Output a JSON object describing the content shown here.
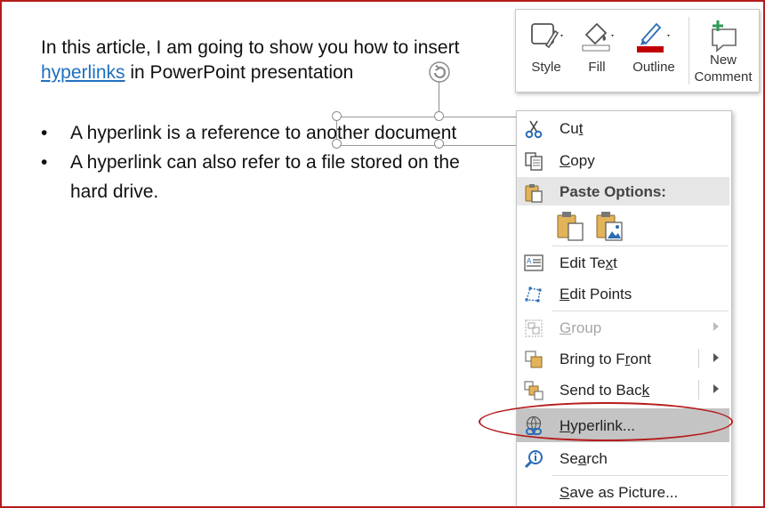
{
  "slide": {
    "intro_text": "In this article, I am going to show you how to insert",
    "intro_link": "hyperlinks",
    "intro_suffix": " in PowerPoint presentation",
    "bullet_char": "•",
    "bullets": [
      {
        "line1": "A hyperlink is a reference to another document"
      },
      {
        "line1": "A hyperlink can also refer to a file stored on the",
        "line2": "hard drive."
      }
    ]
  },
  "mini_toolbar": {
    "items": [
      {
        "label": "Style",
        "icon": "shape-style-icon"
      },
      {
        "label": "Fill",
        "icon": "fill-bucket-icon"
      },
      {
        "label": "Outline",
        "icon": "outline-pen-icon"
      },
      {
        "label": "New Comment",
        "label_line1": "New",
        "label_line2": "Comment",
        "icon": "new-comment-icon"
      }
    ],
    "colors": {
      "fill": "#ffffff",
      "outline": "#c00000"
    }
  },
  "context_menu": {
    "cut": {
      "pre": "Cu",
      "mnemonic": "t",
      "post": ""
    },
    "copy": {
      "pre": "",
      "mnemonic": "C",
      "post": "opy"
    },
    "paste_options": "Paste Options:",
    "edit_text": {
      "pre": "Edit Te",
      "mnemonic": "x",
      "post": "t"
    },
    "edit_points": {
      "pre": "",
      "mnemonic": "E",
      "post": "dit Points"
    },
    "group": {
      "pre": "",
      "mnemonic": "G",
      "post": "roup"
    },
    "bring_to_front": {
      "pre": "Bring to F",
      "mnemonic": "r",
      "post": "ont"
    },
    "send_to_back": {
      "pre": "Send to Bac",
      "mnemonic": "k",
      "post": ""
    },
    "hyperlink": {
      "pre": "",
      "mnemonic": "H",
      "post": "yperlink..."
    },
    "search": {
      "pre": "Se",
      "mnemonic": "a",
      "post": "rch"
    },
    "save_as_picture": {
      "pre": "",
      "mnemonic": "S",
      "post": "ave as Picture..."
    }
  },
  "colors": {
    "frame_border": "#b51c1c",
    "link": "#1f6fbf",
    "highlight_ellipse": "#b51c1c"
  }
}
